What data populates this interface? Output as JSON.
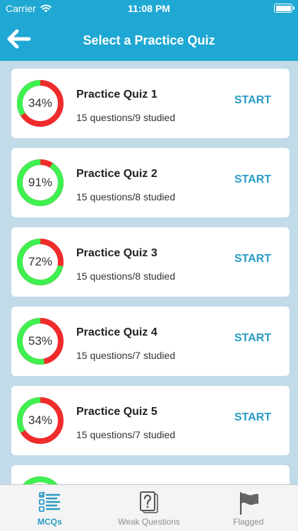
{
  "status_bar": {
    "carrier": "Carrier",
    "time": "11:08 PM"
  },
  "nav": {
    "title": "Select a Practice Quiz"
  },
  "colors": {
    "primary": "#1fa8d3",
    "ring_correct": "#3ef050",
    "ring_wrong": "#ef2b2b",
    "accent": "#2a9bc5"
  },
  "quizzes": [
    {
      "title": "Practice Quiz 1",
      "subtitle": "15 questions/9 studied",
      "percent": 34,
      "percent_label": "34%",
      "action": "START"
    },
    {
      "title": "Practice Quiz 2",
      "subtitle": "15 questions/8 studied",
      "percent": 91,
      "percent_label": "91%",
      "action": "START"
    },
    {
      "title": "Practice Quiz 3",
      "subtitle": "15 questions/8 studied",
      "percent": 72,
      "percent_label": "72%",
      "action": "START"
    },
    {
      "title": "Practice Quiz 4",
      "subtitle": "15 questions/7 studied",
      "percent": 53,
      "percent_label": "53%",
      "action": "START"
    },
    {
      "title": "Practice Quiz 5",
      "subtitle": "15 questions/7 studied",
      "percent": 34,
      "percent_label": "34%",
      "action": "START"
    },
    {
      "title": "",
      "subtitle": "",
      "percent": 100,
      "percent_label": "",
      "action": ""
    }
  ],
  "tabbar": {
    "tabs": [
      {
        "label": "MCQs",
        "icon": "checklist-icon",
        "active": true
      },
      {
        "label": "Weak Questions",
        "icon": "question-doc-icon",
        "active": false
      },
      {
        "label": "Flagged",
        "icon": "flag-icon",
        "active": false
      }
    ]
  }
}
